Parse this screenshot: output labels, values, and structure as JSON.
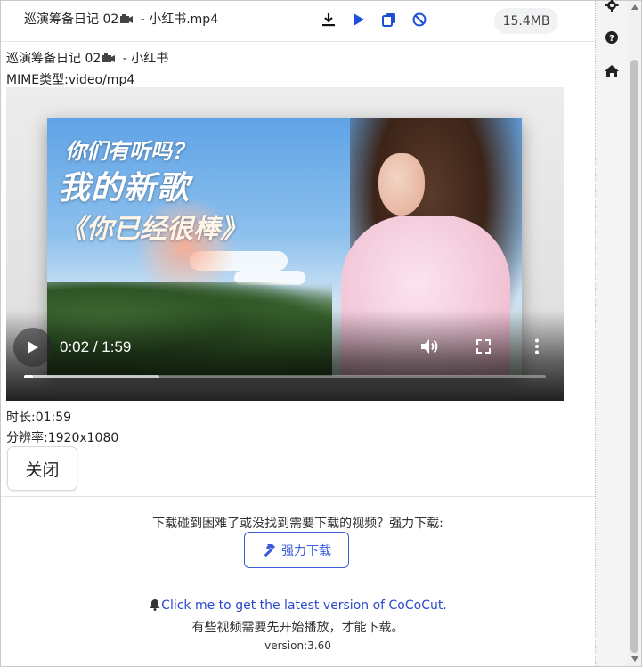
{
  "topbar": {
    "file_title_prefix": "巡演筹备日记 02",
    "file_title_suffix": " - 小红书.mp4",
    "size": "15.4MB",
    "actions": [
      "download",
      "play",
      "copy",
      "block"
    ]
  },
  "info": {
    "title_prefix": "巡演筹备日记 02",
    "title_suffix": " - 小红书",
    "mime": "MIME类型:video/mp4",
    "duration": "时长:01:59",
    "resolution": "分辨率:1920x1080"
  },
  "video": {
    "current_time": "0:02",
    "separator": " / ",
    "total_time": "1:59",
    "played_fraction": 0.017,
    "buffered_fraction": 0.26,
    "poster_line1": "你们有听吗？",
    "poster_line2": "我的新歌",
    "poster_line3": "《你已经很棒》"
  },
  "close_label": "关闭",
  "help_text": "下载碰到困难了或没找到需要下载的视频？强力下载:",
  "force_download_label": "强力下载",
  "update_link": "Click me to get the latest version of CoCoCut.",
  "note": "有些视频需要先开始播放，才能下载。",
  "version": "version:3.60",
  "sidebar": [
    "settings",
    "help",
    "home"
  ],
  "colors": {
    "accent": "#3b5bdb",
    "link": "#2b4acb",
    "badge_bg": "#f1f2f4"
  }
}
